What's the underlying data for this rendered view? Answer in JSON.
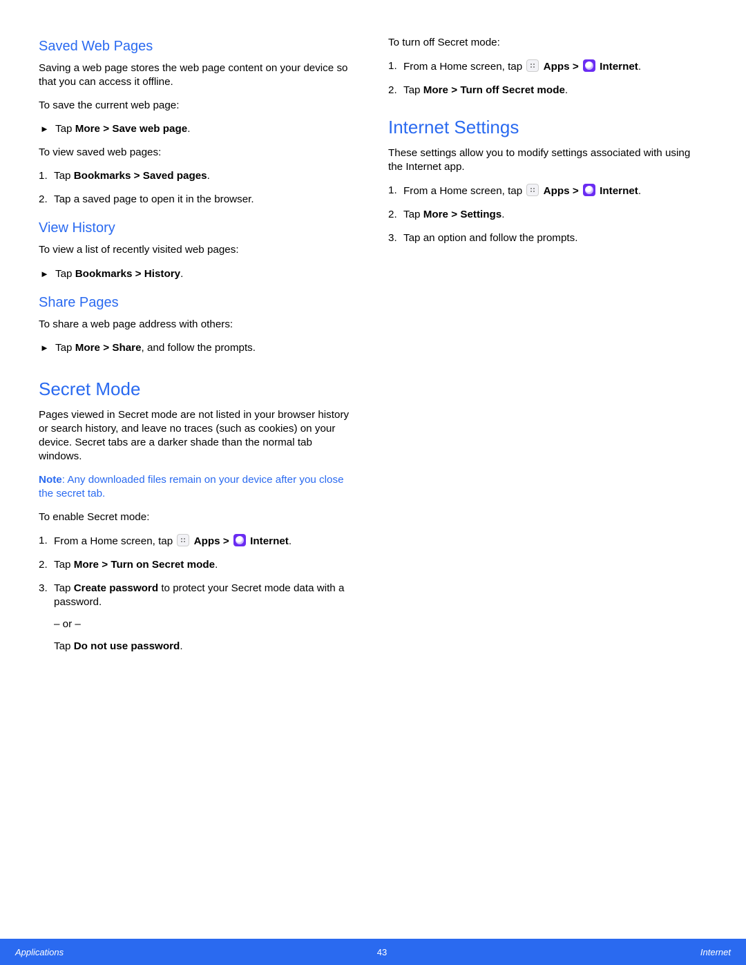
{
  "footer": {
    "left": "Applications",
    "center": "43",
    "right": "Internet"
  },
  "left": {
    "saved": {
      "heading": "Saved Web Pages",
      "intro": "Saving a web page stores the web page content on your device so that you can access it offline.",
      "to_save": "To save the current web page:",
      "save_step_pre": "Tap ",
      "save_step_bold": "More > Save web page",
      "to_view": "To view saved web pages:",
      "view_1_pre": "Tap ",
      "view_1_bold": "Bookmarks > Saved pages",
      "view_2": "Tap a saved page to open it in the browser."
    },
    "history": {
      "heading": "View History",
      "intro": "To view a list of recently visited web pages:",
      "step_pre": "Tap ",
      "step_bold": "Bookmarks > History"
    },
    "share": {
      "heading": "Share Pages",
      "intro": "To share a web page address with others:",
      "step_pre": "Tap ",
      "step_bold": "More > Share",
      "step_post": ", and follow the prompts."
    },
    "secret": {
      "heading": "Secret Mode",
      "intro": "Pages viewed in Secret mode are not listed in your browser history or search history, and leave no traces (such as cookies) on your device. Secret tabs are a darker shade than the normal tab windows.",
      "note_bold": "Note",
      "note_rest": ": Any downloaded files remain on your device after you close the secret tab.",
      "enable_intro": "To enable Secret mode:",
      "s1_pre": "From a Home screen, tap ",
      "apps_label": "Apps",
      "gt": " > ",
      "internet_label": "Internet",
      "s2_pre": "Tap ",
      "s2_bold": "More > Turn on Secret mode",
      "s3_pre": " Tap ",
      "s3_bold": "Create password",
      "s3_post": " to protect your Secret mode data with a password.",
      "or": "– or –",
      "s3b_pre": "Tap ",
      "s3b_bold": "Do not use password"
    }
  },
  "right": {
    "off": {
      "intro": "To turn off Secret mode:",
      "s1_pre": "From a Home screen, tap ",
      "apps_label": "Apps",
      "gt": " > ",
      "internet_label": "Internet",
      "s2_pre": "Tap ",
      "s2_bold": "More > Turn off Secret mode"
    },
    "settings": {
      "heading": "Internet Settings",
      "intro": "These settings allow you to modify settings associated with using the Internet app.",
      "s1_pre": "From a Home screen, tap ",
      "apps_label": "Apps",
      "gt": " > ",
      "internet_label": "Internet",
      "s2_pre": "Tap ",
      "s2_bold": "More > Settings",
      "s3": "Tap an option and follow the prompts."
    }
  }
}
